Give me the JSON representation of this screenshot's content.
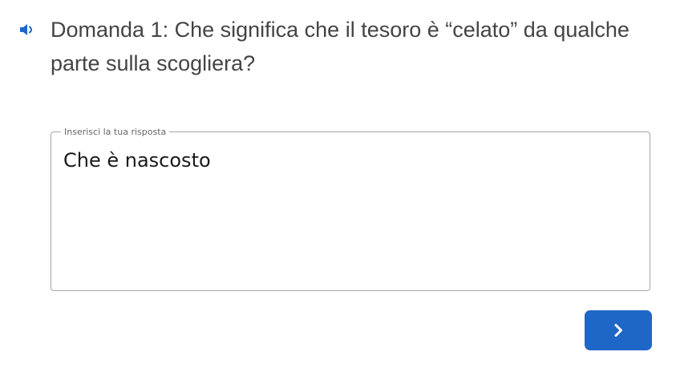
{
  "question": {
    "text": "Domanda 1: Che significa che il tesoro è “celato” da qualche parte sulla scogliera?",
    "audio_icon": "speaker-icon"
  },
  "answer": {
    "label": "Inserisci la tua risposta",
    "value": "Che è nascosto"
  },
  "next_button": {
    "icon": "chevron-right-icon"
  },
  "colors": {
    "accent": "#1f67c7",
    "question_text": "#444444",
    "field_border": "#a6a6a6"
  }
}
